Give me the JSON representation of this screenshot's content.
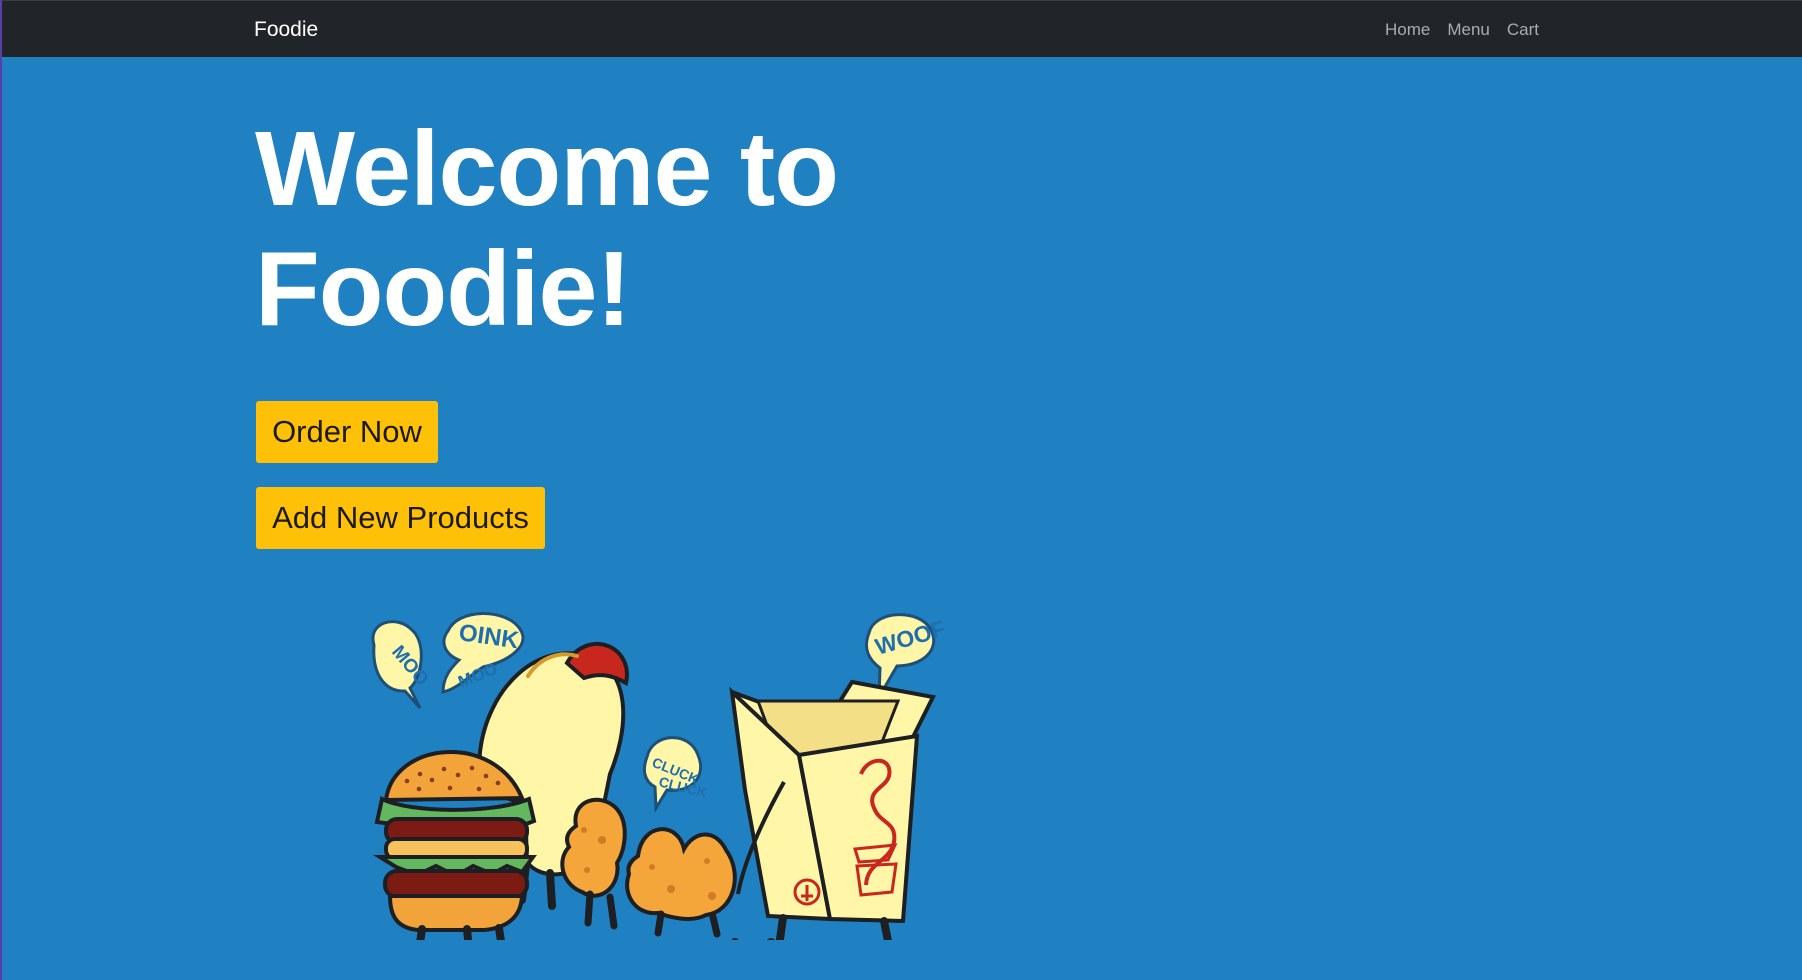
{
  "navbar": {
    "brand": "Foodie",
    "links": [
      "Home",
      "Menu",
      "Cart"
    ]
  },
  "hero": {
    "title_line1": "Welcome to",
    "title_line2": "Foodie!",
    "buttons": {
      "order_now": "Order Now",
      "add_products": "Add New Products"
    }
  },
  "illustration": {
    "speech_bubbles": [
      "MOO",
      "OINK",
      "MOO",
      "CLUCK",
      "CLUCK",
      "WOOF"
    ],
    "icons": [
      "burger-icon",
      "hotdog-icon",
      "nugget-icon",
      "takeout-box-icon"
    ]
  },
  "colors": {
    "background": "#1f81c1",
    "navbar": "#212429",
    "button": "#ffc107",
    "title": "#ffffff",
    "nav_link": "#a8acb1"
  }
}
